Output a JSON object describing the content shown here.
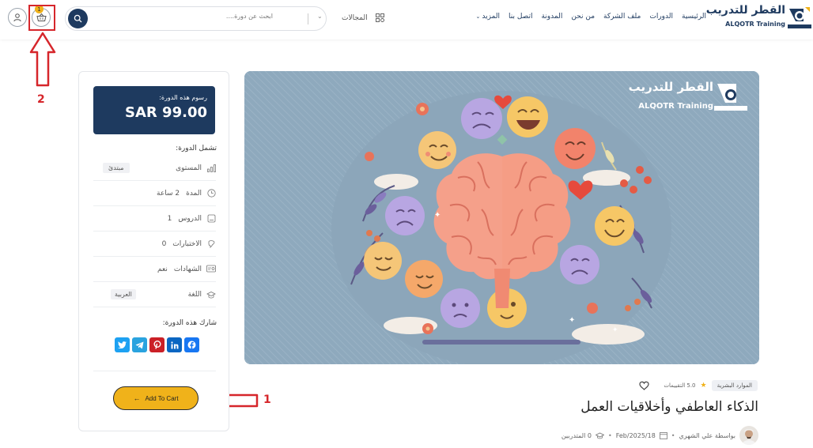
{
  "header": {
    "logo": {
      "ar": "القطر للتدريب",
      "en": "ALQOTR Training"
    },
    "nav": [
      "الرئيسية",
      "الدورات",
      "ملف الشركة",
      "من نحن",
      "المدونة",
      "اتصل بنا",
      "المزيد"
    ],
    "search": {
      "placeholder": "ابحث عن دورة....",
      "category_label": "المجالات"
    },
    "cart_count": "1"
  },
  "annotations": {
    "cart_marker": "2",
    "button_marker": "1"
  },
  "sidebar": {
    "price_label": "رسوم هذه الدورة:",
    "price": "SAR 99.00",
    "includes_title": "تشمل الدورة:",
    "rows": [
      {
        "label": "المستوى",
        "value": "مبتدئ",
        "icon": "level-icon"
      },
      {
        "label": "المدة",
        "value": "2 ساعة",
        "icon": "clock-icon"
      },
      {
        "label": "الدروس",
        "value": "1",
        "icon": "lessons-icon"
      },
      {
        "label": "الاختبارات",
        "value": "0",
        "icon": "quiz-icon"
      },
      {
        "label": "الشهادات",
        "value": "نعم",
        "icon": "certificate-icon"
      },
      {
        "label": "اللغة",
        "value": "العربية",
        "icon": "language-icon"
      }
    ],
    "share_title": "شارك هذه الدورة:",
    "add_to_cart": "Add To Cart",
    "colors": {
      "primary": "#1e3a5f",
      "accent": "#f0b21a"
    }
  },
  "hero": {
    "logo_ar": "القطر للتدريب",
    "logo_en": "ALQOTR Training"
  },
  "course": {
    "category": "الموارد البشرية",
    "rating": "5.0 التقييمات",
    "title": "الذكاء العاطفي وأخلاقيات العمل",
    "instructor": "بواسطة علي الشهري",
    "date": "Feb/2025/18",
    "students": "0 المتدربين"
  }
}
